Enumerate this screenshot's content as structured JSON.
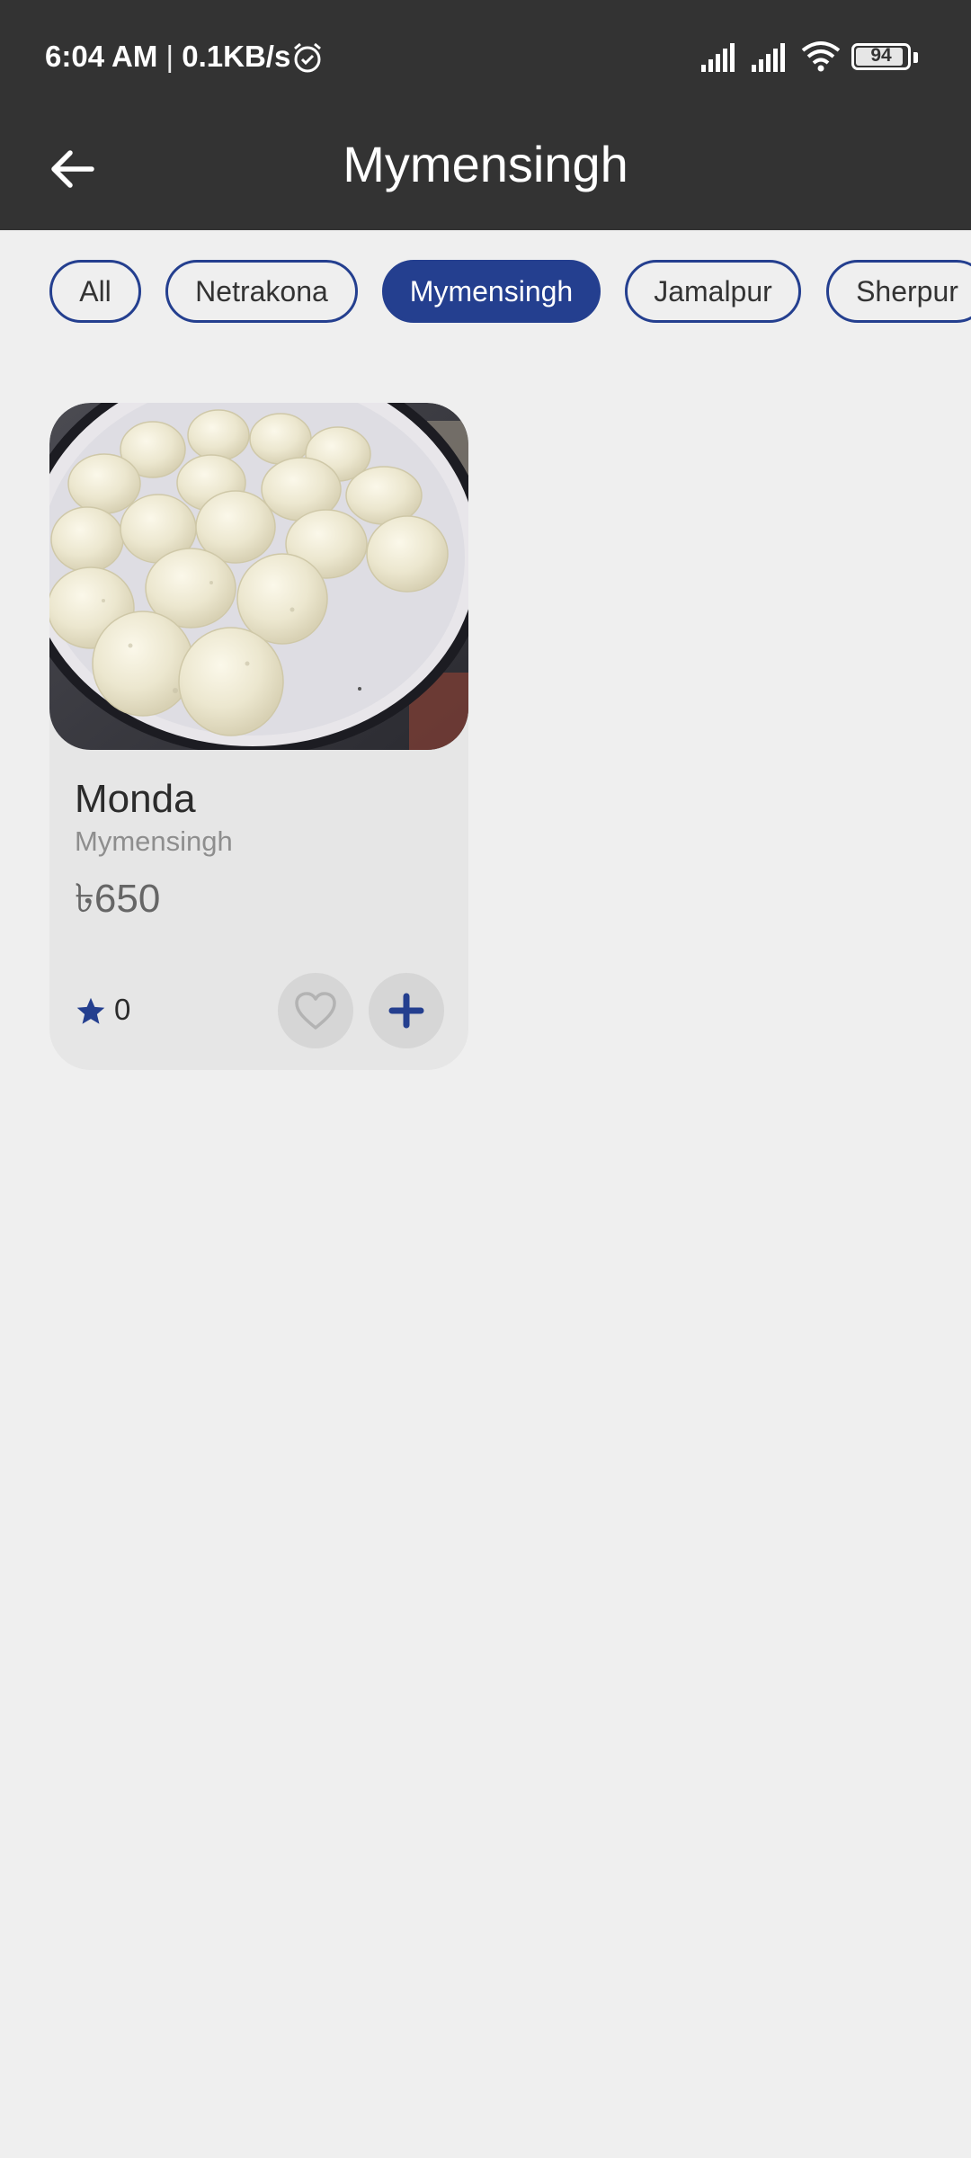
{
  "status_bar": {
    "time": "6:04 AM",
    "separator": "|",
    "speed": "0.1KB/s",
    "battery": "94",
    "icons": [
      "alarm-icon",
      "signal-icon",
      "signal-icon",
      "wifi-icon",
      "battery-icon"
    ]
  },
  "app_bar": {
    "title": "Mymensingh",
    "back_icon": "arrow-left-icon"
  },
  "filters": {
    "items": [
      {
        "label": "All",
        "active": false
      },
      {
        "label": "Netrakona",
        "active": false
      },
      {
        "label": "Mymensingh",
        "active": true
      },
      {
        "label": "Jamalpur",
        "active": false
      },
      {
        "label": "Sherpur",
        "active": false
      }
    ]
  },
  "products": [
    {
      "name": "Monda",
      "location": "Mymensingh",
      "price": "৳650",
      "rating": "0",
      "icons": [
        "star-icon",
        "heart-outline-icon",
        "plus-icon"
      ]
    }
  ],
  "colors": {
    "header": "#333333",
    "accent": "#243f8f",
    "background": "#efefef",
    "card": "#e6e6e6"
  }
}
